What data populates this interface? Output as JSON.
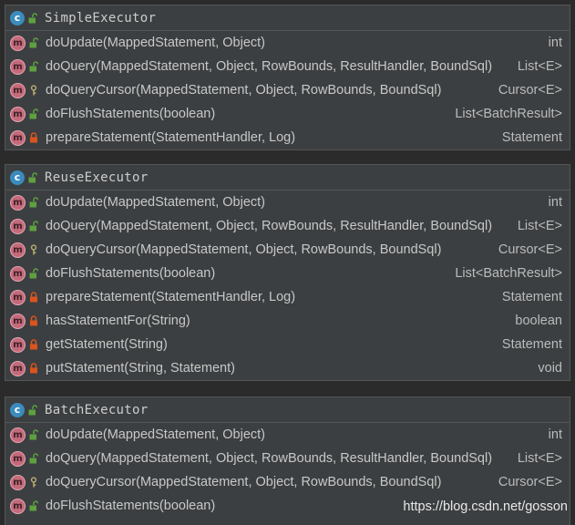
{
  "panels": [
    {
      "class_name": "SimpleExecutor",
      "class_icon": "class-icon",
      "class_icon_letter": "c",
      "methods": [
        {
          "name": "doUpdate(MappedStatement, Object)",
          "return_type": "int",
          "visibility": "public"
        },
        {
          "name": "doQuery(MappedStatement, Object, RowBounds, ResultHandler, BoundSql)",
          "return_type": "List<E>",
          "visibility": "public"
        },
        {
          "name": "doQueryCursor(MappedStatement, Object, RowBounds, BoundSql)",
          "return_type": "Cursor<E>",
          "visibility": "protected"
        },
        {
          "name": "doFlushStatements(boolean)",
          "return_type": "List<BatchResult>",
          "visibility": "public"
        },
        {
          "name": "prepareStatement(StatementHandler, Log)",
          "return_type": "Statement",
          "visibility": "private"
        }
      ]
    },
    {
      "class_name": "ReuseExecutor",
      "class_icon": "class-icon",
      "class_icon_letter": "c",
      "methods": [
        {
          "name": "doUpdate(MappedStatement, Object)",
          "return_type": "int",
          "visibility": "public"
        },
        {
          "name": "doQuery(MappedStatement, Object, RowBounds, ResultHandler, BoundSql)",
          "return_type": "List<E>",
          "visibility": "public"
        },
        {
          "name": "doQueryCursor(MappedStatement, Object, RowBounds, BoundSql)",
          "return_type": "Cursor<E>",
          "visibility": "protected"
        },
        {
          "name": "doFlushStatements(boolean)",
          "return_type": "List<BatchResult>",
          "visibility": "public"
        },
        {
          "name": "prepareStatement(StatementHandler, Log)",
          "return_type": "Statement",
          "visibility": "private"
        },
        {
          "name": "hasStatementFor(String)",
          "return_type": "boolean",
          "visibility": "private"
        },
        {
          "name": "getStatement(String)",
          "return_type": "Statement",
          "visibility": "private"
        },
        {
          "name": "putStatement(String, Statement)",
          "return_type": "void",
          "visibility": "private"
        }
      ]
    },
    {
      "class_name": "BatchExecutor",
      "class_icon": "class-icon",
      "class_icon_letter": "c",
      "methods": [
        {
          "name": "doUpdate(MappedStatement, Object)",
          "return_type": "int",
          "visibility": "public"
        },
        {
          "name": "doQuery(MappedStatement, Object, RowBounds, ResultHandler, BoundSql)",
          "return_type": "List<E>",
          "visibility": "public"
        },
        {
          "name": "doQueryCursor(MappedStatement, Object, RowBounds, BoundSql)",
          "return_type": "Cursor<E>",
          "visibility": "protected"
        },
        {
          "name": "doFlushStatements(boolean)",
          "return_type": "",
          "visibility": "public"
        }
      ]
    }
  ],
  "method_icon_letter": "m",
  "watermark": "https://blog.csdn.net/gosson",
  "colors": {
    "background": "#2b2b2b",
    "panel": "#3c3f41",
    "class_icon": "#3b8bbd",
    "method_icon": "#c36a7b",
    "public": "#5fa040",
    "private": "#d9541e",
    "protected": "#b8b070"
  }
}
